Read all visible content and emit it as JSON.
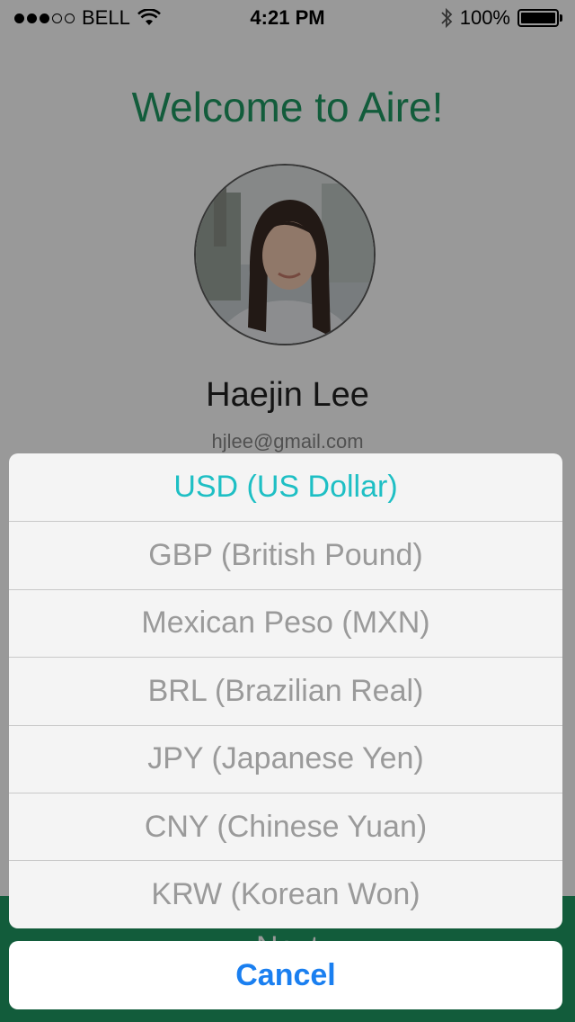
{
  "status_bar": {
    "carrier": "BELL",
    "time": "4:21 PM",
    "battery": "100%"
  },
  "profile": {
    "welcome_title": "Welcome to Aire!",
    "name": "Haejin Lee",
    "email": "hjlee@gmail.com"
  },
  "footer": {
    "next_label": "Next"
  },
  "colors": {
    "accent_green": "#1f9a63",
    "selected_teal": "#1ebfc4",
    "cancel_blue": "#1a7ff0"
  },
  "currency_sheet": {
    "options": [
      "USD (US Dollar)",
      "GBP (British Pound)",
      "Mexican Peso (MXN)",
      "BRL (Brazilian Real)",
      "JPY (Japanese Yen)",
      "CNY (Chinese Yuan)",
      "KRW (Korean Won)"
    ],
    "selected": "USD (US Dollar)",
    "cancel_label": "Cancel"
  }
}
